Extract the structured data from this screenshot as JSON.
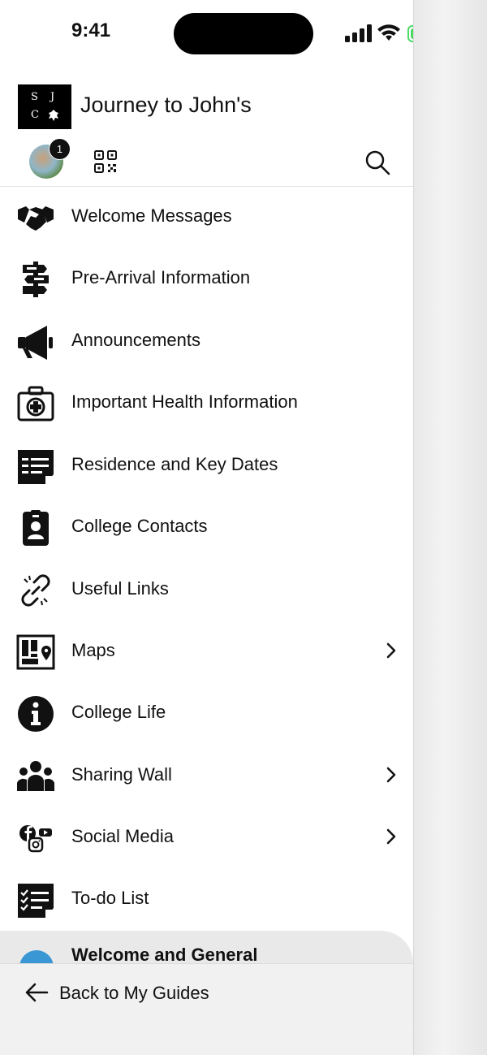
{
  "status_bar": {
    "time": "9:41"
  },
  "header": {
    "logo_letters": [
      "S",
      "J",
      "C"
    ],
    "title": "Journey to John's",
    "notification_count": "1"
  },
  "menu": [
    {
      "label": "Welcome Messages",
      "icon": "handshake-icon",
      "has_chevron": false
    },
    {
      "label": "Pre-Arrival Information",
      "icon": "signpost-icon",
      "has_chevron": false
    },
    {
      "label": "Announcements",
      "icon": "megaphone-icon",
      "has_chevron": false
    },
    {
      "label": "Important Health Information",
      "icon": "first-aid-kit-icon",
      "has_chevron": false
    },
    {
      "label": "Residence and Key Dates",
      "icon": "notepad-icon",
      "has_chevron": false
    },
    {
      "label": "College Contacts",
      "icon": "id-badge-icon",
      "has_chevron": false
    },
    {
      "label": "Useful Links",
      "icon": "broken-link-icon",
      "has_chevron": false
    },
    {
      "label": "Maps",
      "icon": "map-icon",
      "has_chevron": true
    },
    {
      "label": "College Life",
      "icon": "info-icon",
      "has_chevron": false
    },
    {
      "label": "Sharing Wall",
      "icon": "group-icon",
      "has_chevron": true
    },
    {
      "label": "Social Media",
      "icon": "social-media-icon",
      "has_chevron": true
    },
    {
      "label": "To-do List",
      "icon": "checklist-icon",
      "has_chevron": false
    }
  ],
  "current_section": {
    "label": "Welcome and General",
    "accent": "#3a97d4"
  },
  "footer": {
    "back_label": "Back to My Guides"
  }
}
